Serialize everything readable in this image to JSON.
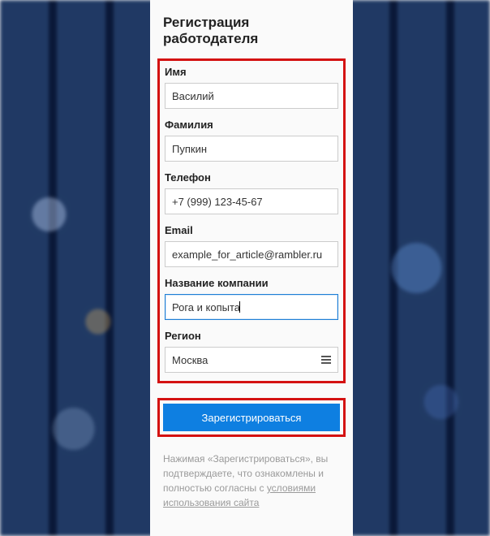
{
  "title": "Регистрация работодателя",
  "fields": {
    "firstname": {
      "label": "Имя",
      "value": "Василий"
    },
    "lastname": {
      "label": "Фамилия",
      "value": "Пупкин"
    },
    "phone": {
      "label": "Телефон",
      "value": "+7 (999) 123-45-67"
    },
    "email": {
      "label": "Email",
      "value": "example_for_article@rambler.ru"
    },
    "company": {
      "label": "Название компании",
      "value": "Рога и копыта"
    },
    "region": {
      "label": "Регион",
      "value": "Москва"
    }
  },
  "submit_label": "Зарегистрироваться",
  "disclaimer": {
    "line1": "Нажимая «Зарегистрироваться», вы подтверждаете, что ознакомлены и полностью согласны с ",
    "link_text": "условиями использования сайта"
  }
}
